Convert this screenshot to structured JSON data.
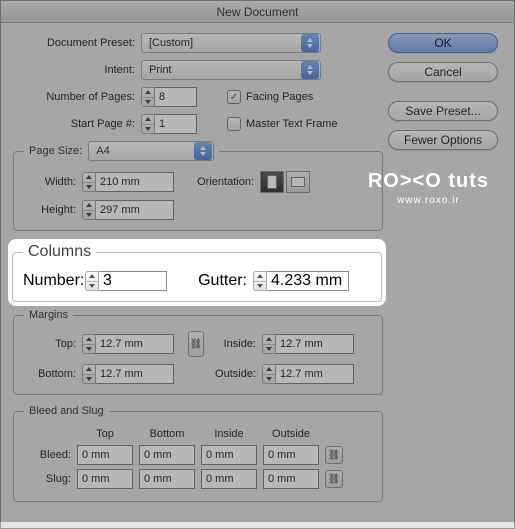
{
  "title": "New Document",
  "buttons": {
    "ok": "OK",
    "cancel": "Cancel",
    "savePreset": "Save Preset...",
    "fewerOptions": "Fewer Options"
  },
  "top": {
    "presetLabel": "Document Preset:",
    "presetValue": "[Custom]",
    "intentLabel": "Intent:",
    "intentValue": "Print",
    "pagesLabel": "Number of Pages:",
    "pagesValue": "8",
    "startLabel": "Start Page #:",
    "startValue": "1",
    "facing": "Facing Pages",
    "master": "Master Text Frame"
  },
  "pageSize": {
    "legend": "Page Size:",
    "value": "A4",
    "widthLabel": "Width:",
    "widthValue": "210 mm",
    "heightLabel": "Height:",
    "heightValue": "297 mm",
    "orientationLabel": "Orientation:"
  },
  "columns": {
    "legend": "Columns",
    "numberLabel": "Number:",
    "numberValue": "3",
    "gutterLabel": "Gutter:",
    "gutterValue": "4.233 mm"
  },
  "margins": {
    "legend": "Margins",
    "topLabel": "Top:",
    "topValue": "12.7 mm",
    "bottomLabel": "Bottom:",
    "bottomValue": "12.7 mm",
    "insideLabel": "Inside:",
    "insideValue": "12.7 mm",
    "outsideLabel": "Outside:",
    "outsideValue": "12.7 mm"
  },
  "bleedSlug": {
    "legend": "Bleed and Slug",
    "headers": {
      "top": "Top",
      "bottom": "Bottom",
      "inside": "Inside",
      "outside": "Outside"
    },
    "bleedLabel": "Bleed:",
    "slugLabel": "Slug:",
    "bleed": {
      "top": "0 mm",
      "bottom": "0 mm",
      "inside": "0 mm",
      "outside": "0 mm"
    },
    "slug": {
      "top": "0 mm",
      "bottom": "0 mm",
      "inside": "0 mm",
      "outside": "0 mm"
    }
  },
  "watermark": {
    "logo": "RO><O tuts",
    "url": "www.roxo.ir"
  }
}
